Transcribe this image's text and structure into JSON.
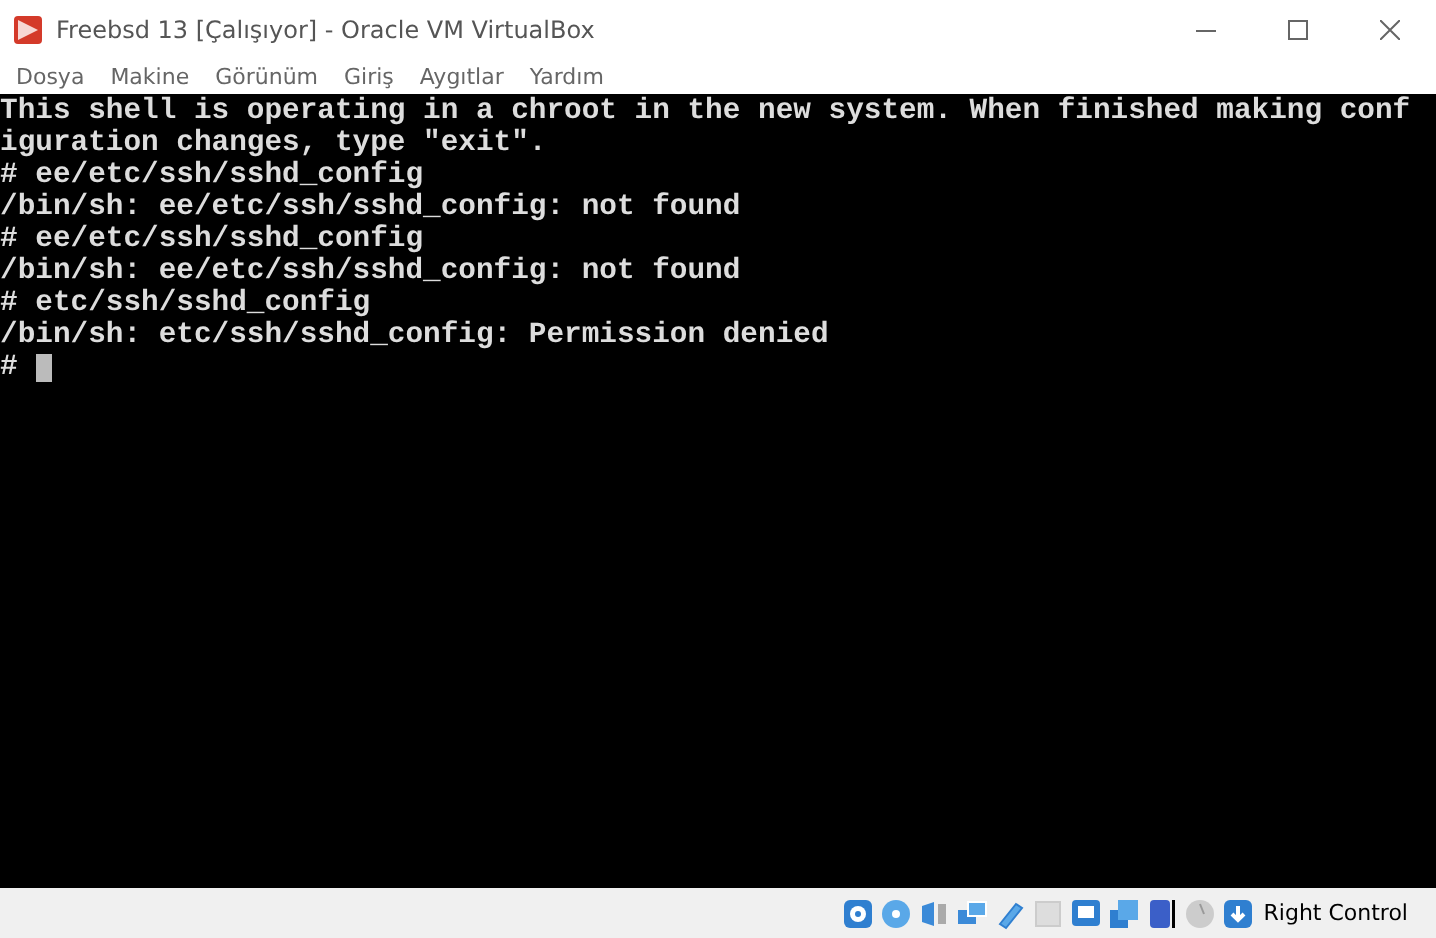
{
  "window": {
    "title": "Freebsd 13 [Çalışıyor] - Oracle VM VirtualBox"
  },
  "menu": [
    "Dosya",
    "Makine",
    "Görünüm",
    "Giriş",
    "Aygıtlar",
    "Yardım"
  ],
  "console": {
    "lines": [
      "This shell is operating in a chroot in the new system. When finished making conf",
      "iguration changes, type \"exit\".",
      "# ee/etc/ssh/sshd_config",
      "/bin/sh: ee/etc/ssh/sshd_config: not found",
      "# ee/etc/ssh/sshd_config",
      "/bin/sh: ee/etc/ssh/sshd_config: not found",
      "# etc/ssh/sshd_config",
      "/bin/sh: etc/ssh/sshd_config: Permission denied",
      "#"
    ],
    "cursor": true
  },
  "status_bar": {
    "host_key": "Right Control"
  }
}
